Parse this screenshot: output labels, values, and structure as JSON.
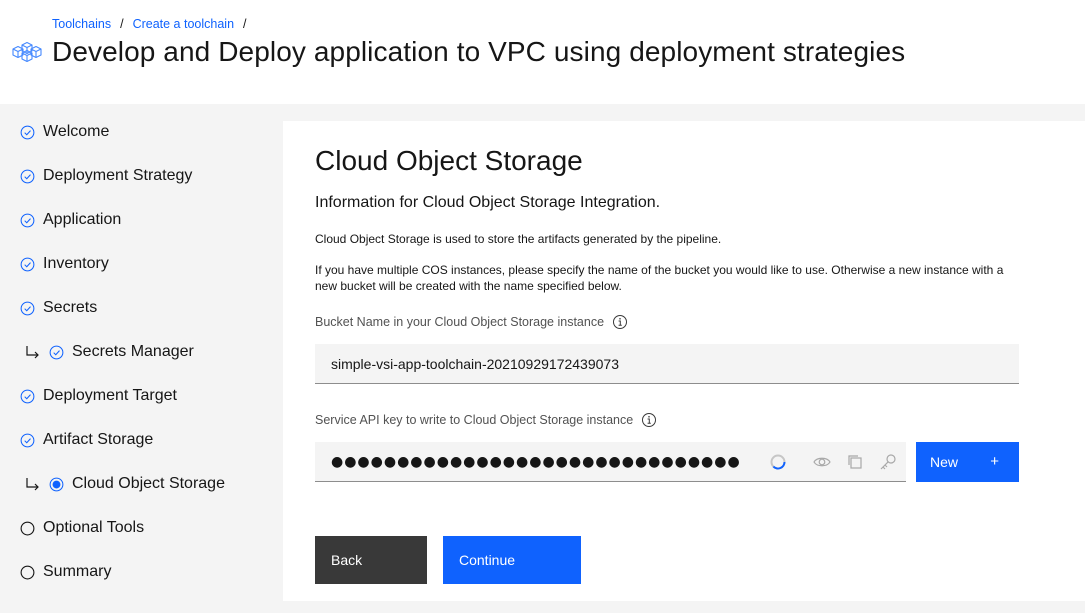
{
  "breadcrumb": {
    "items": [
      "Toolchains",
      "Create a toolchain"
    ],
    "separator": "/"
  },
  "header": {
    "title": "Develop and Deploy application to VPC using deployment strategies",
    "icon": "toolchain-cubes-icon"
  },
  "sidebar": {
    "steps": [
      {
        "label": "Welcome",
        "state": "complete"
      },
      {
        "label": "Deployment Strategy",
        "state": "complete"
      },
      {
        "label": "Application",
        "state": "complete"
      },
      {
        "label": "Inventory",
        "state": "complete"
      },
      {
        "label": "Secrets",
        "state": "complete"
      },
      {
        "label": "Secrets Manager",
        "state": "complete",
        "sub": true
      },
      {
        "label": "Deployment Target",
        "state": "complete"
      },
      {
        "label": "Artifact Storage",
        "state": "complete"
      },
      {
        "label": "Cloud Object Storage",
        "state": "current",
        "sub": true
      },
      {
        "label": "Optional Tools",
        "state": "incomplete"
      },
      {
        "label": "Summary",
        "state": "incomplete"
      }
    ]
  },
  "panel": {
    "title": "Cloud Object Storage",
    "subtitle": "Information for Cloud Object Storage Integration.",
    "description1": "Cloud Object Storage is used to store the artifacts generated by the pipeline.",
    "description2": "If you have multiple COS instances, please specify the name of the bucket you would like to use. Otherwise a new instance with a new bucket will be created with the name specified below.",
    "bucket": {
      "label": "Bucket Name in your Cloud Object Storage instance",
      "value": "simple-vsi-app-toolchain-20210929172439073"
    },
    "apikey": {
      "label": "Service API key to write to Cloud Object Storage instance",
      "value": "●●●●●●●●●●●●●●●●●●●●●●●●●●●●●●●●●●●●●●●●●●●●"
    },
    "new_button": {
      "label": "New",
      "icon": "+"
    }
  },
  "buttons": {
    "back": "Back",
    "continue": "Continue"
  },
  "colors": {
    "primary": "#0f62fe",
    "secondary": "#393939",
    "background": "#f4f4f4"
  }
}
